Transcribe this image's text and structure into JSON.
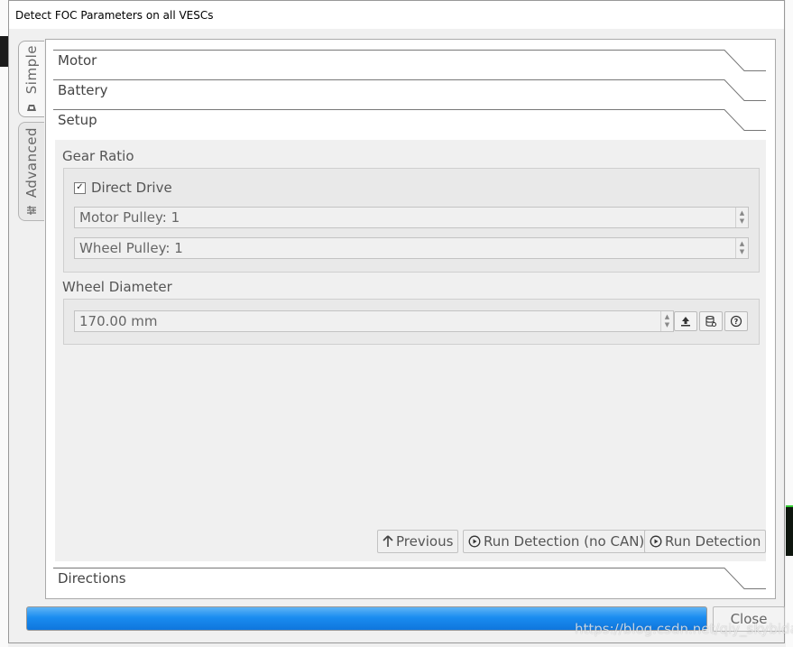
{
  "window": {
    "title": "Detect FOC Parameters on all VESCs"
  },
  "side_tabs": [
    {
      "label": "Simple",
      "icon": "motor-icon",
      "active": true
    },
    {
      "label": "Advanced",
      "icon": "sliders-icon",
      "active": false
    }
  ],
  "sections": {
    "motor": "Motor",
    "battery": "Battery",
    "setup": "Setup",
    "directions": "Directions"
  },
  "setup": {
    "gear_ratio": {
      "title": "Gear Ratio",
      "direct_drive_label": "Direct Drive",
      "direct_drive_checked": true,
      "motor_pulley": "Motor Pulley: 1",
      "wheel_pulley": "Wheel Pulley: 1"
    },
    "wheel_diameter": {
      "title": "Wheel Diameter",
      "value": "170.00 mm"
    },
    "buttons": {
      "previous": "Previous",
      "run_detection_no_can": "Run Detection (no CAN)",
      "run_detection": "Run Detection"
    }
  },
  "footer": {
    "close": "Close",
    "progress_percent": 100,
    "watermark": "https://blog.csdn.net/qiy_skybida"
  },
  "colors": {
    "progress": "#1a8cf0",
    "background": "#f0f0f0"
  }
}
